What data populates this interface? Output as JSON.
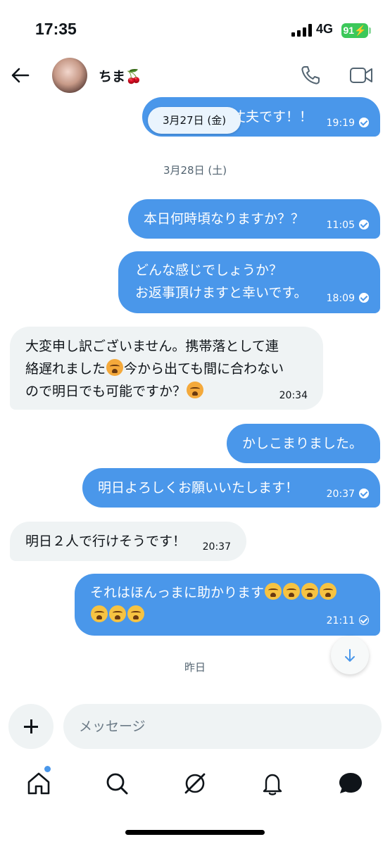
{
  "status_bar": {
    "time": "17:35",
    "network": "4G",
    "battery": "91"
  },
  "header": {
    "contact_name": "ちま",
    "contact_emoji": "🍒"
  },
  "date_pill": "3月27日 (金)",
  "messages": [
    {
      "direction": "out",
      "text": "丈夫です！！",
      "time": "19:19",
      "status": "read"
    },
    {
      "direction": "out",
      "text": "本日何時頃なりますか？？",
      "time": "11:05",
      "status": "read"
    },
    {
      "direction": "out",
      "lines": [
        "どんな感じでしょうか？",
        "お返事頂けますと幸いです。"
      ],
      "time": "18:09",
      "status": "read"
    },
    {
      "direction": "in",
      "lines": [
        "大変申し訳ございません。携帯落として連",
        "絡遅れました",
        "今から出ても間に合わない",
        "ので明日でも可能ですか？"
      ],
      "time": "20:34"
    },
    {
      "direction": "out",
      "text": "かしこまりました。"
    },
    {
      "direction": "out",
      "text": "明日よろしくお願いいたします！",
      "time": "20:37",
      "status": "read"
    },
    {
      "direction": "in",
      "text": "明日２人で行けそうです！",
      "time": "20:37"
    },
    {
      "direction": "out",
      "text": "それはほんっまに助かります",
      "time": "21:11",
      "status": "sent"
    }
  ],
  "date_separators": {
    "sat": "3月28日 (土)",
    "yesterday": "昨日"
  },
  "composer": {
    "placeholder": "メッセージ"
  },
  "icons": {
    "back": "arrow-left-icon",
    "phone": "phone-icon",
    "video": "video-icon",
    "scroll": "arrow-down-icon",
    "plus": "plus-icon",
    "tabs": [
      "home-icon",
      "search-icon",
      "grok-icon",
      "bell-icon",
      "messages-icon"
    ]
  },
  "colors": {
    "accent": "#4a97ea",
    "incoming_bubble": "#eff3f4",
    "battery": "#3cc85a"
  }
}
